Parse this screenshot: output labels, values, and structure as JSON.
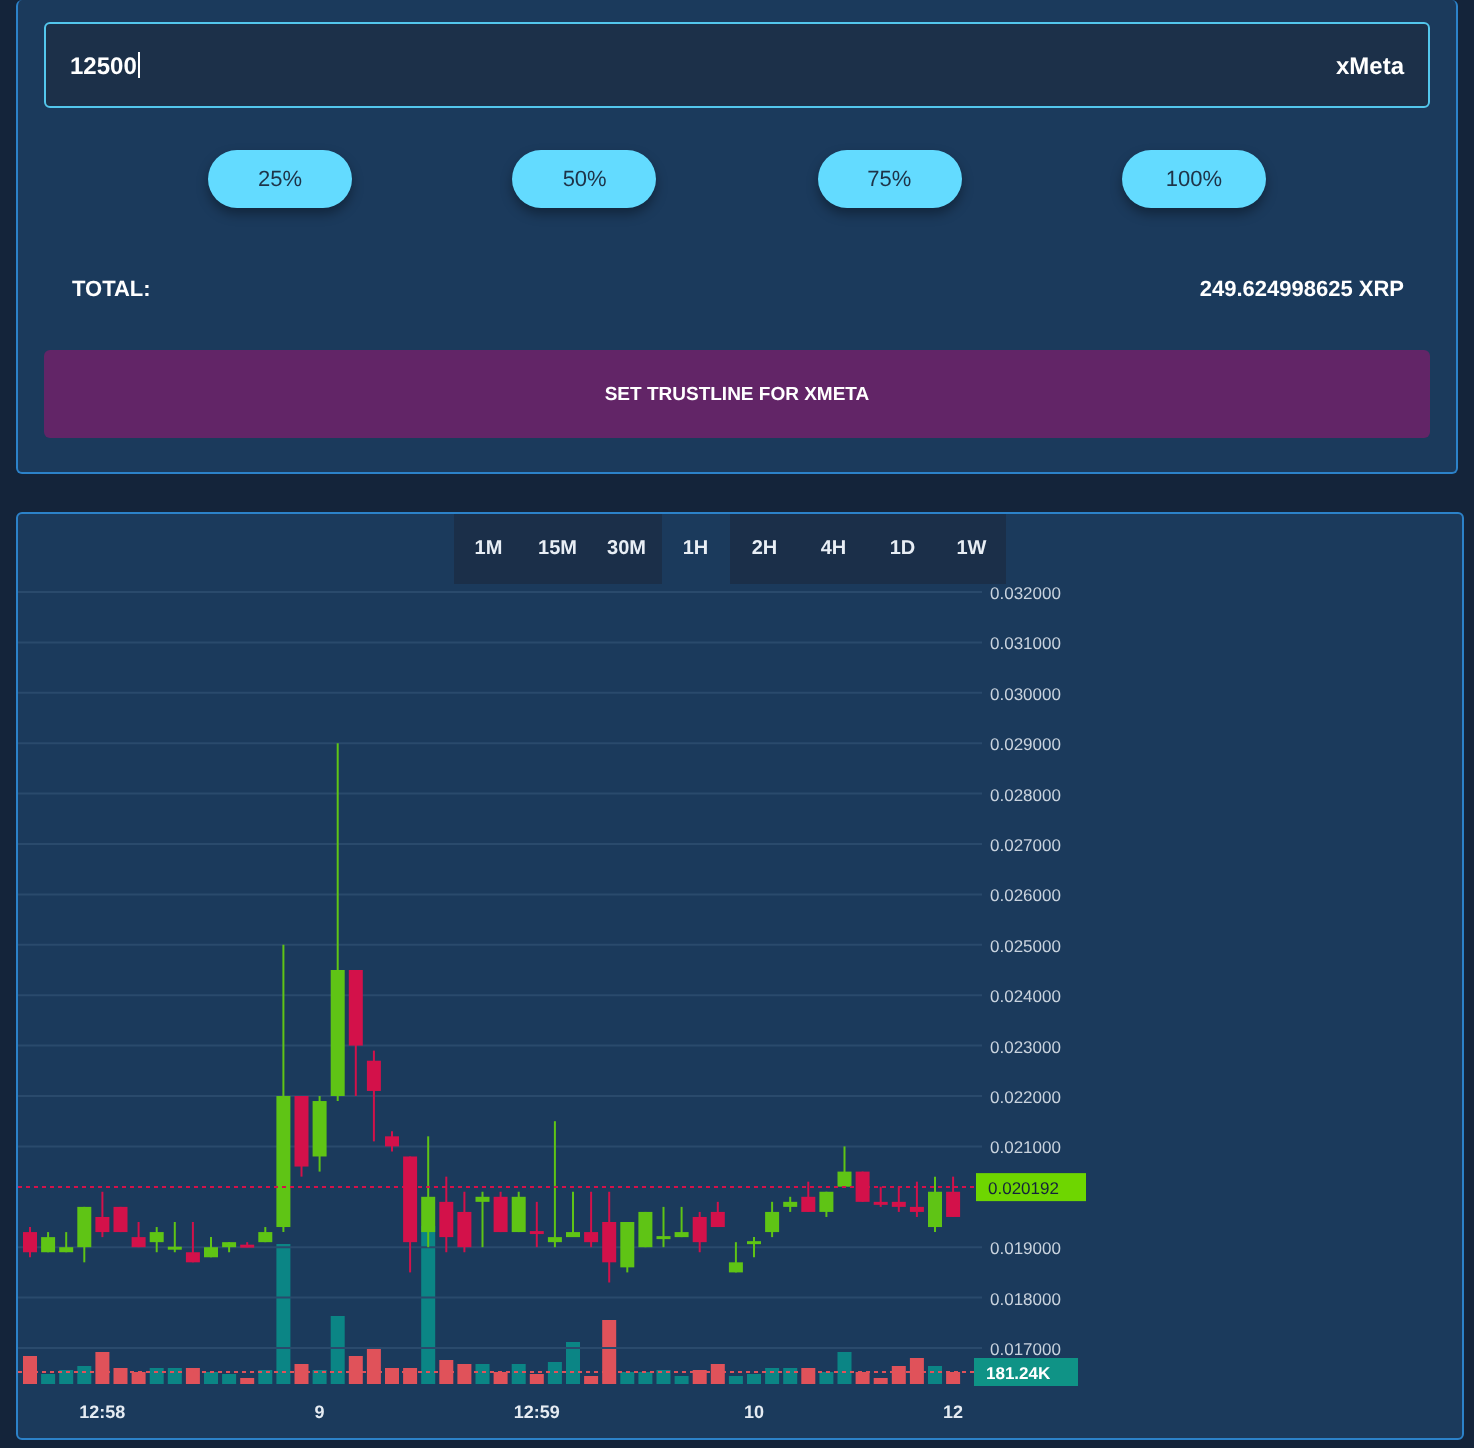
{
  "order": {
    "amount": {
      "value": "12500",
      "unit": "xMeta"
    },
    "percent_buttons": [
      "25%",
      "50%",
      "75%",
      "100%"
    ],
    "total": {
      "label": "TOTAL:",
      "value": "249.624998625 XRP"
    },
    "submit_button": "SET TRUSTLINE FOR XMETA"
  },
  "chart": {
    "timeframes": [
      {
        "label": "1M",
        "selected": false
      },
      {
        "label": "15M",
        "selected": false
      },
      {
        "label": "30M",
        "selected": false
      },
      {
        "label": "1H",
        "selected": true
      },
      {
        "label": "2H",
        "selected": false
      },
      {
        "label": "4H",
        "selected": false
      },
      {
        "label": "1D",
        "selected": false
      },
      {
        "label": "1W",
        "selected": false
      }
    ],
    "chart_data": {
      "type": "candlestick",
      "categories": [
        null,
        null,
        null,
        null,
        "12:58",
        null,
        null,
        null,
        null,
        null,
        null,
        null,
        null,
        null,
        null,
        null,
        "9",
        null,
        null,
        null,
        null,
        null,
        null,
        null,
        null,
        null,
        null,
        null,
        "12:59",
        null,
        null,
        null,
        null,
        null,
        null,
        null,
        null,
        null,
        null,
        null,
        "10",
        null,
        null,
        null,
        null,
        null,
        null,
        null,
        null,
        null,
        null,
        "12"
      ],
      "ohlc": [
        [
          0.0193,
          0.0194,
          0.0188,
          0.0189
        ],
        [
          0.0189,
          0.0193,
          0.0189,
          0.0192
        ],
        [
          0.0189,
          0.0193,
          0.0189,
          0.019
        ],
        [
          0.019,
          0.0198,
          0.0187,
          0.0198
        ],
        [
          0.0196,
          0.0201,
          0.0192,
          0.0193
        ],
        [
          0.0198,
          0.0198,
          0.0193,
          0.0193
        ],
        [
          0.0192,
          0.0195,
          0.019,
          0.019
        ],
        [
          0.0191,
          0.0194,
          0.0189,
          0.0193
        ],
        [
          0.019,
          0.0195,
          0.0189,
          0.01901
        ],
        [
          0.0189,
          0.0195,
          0.0187,
          0.0187
        ],
        [
          0.0188,
          0.0192,
          0.0188,
          0.019
        ],
        [
          0.019,
          0.0191,
          0.0189,
          0.0191
        ],
        [
          0.01905,
          0.0191,
          0.019,
          0.01902
        ],
        [
          0.0191,
          0.0194,
          0.0191,
          0.0193
        ],
        [
          0.0194,
          0.025,
          0.0193,
          0.022
        ],
        [
          0.022,
          0.022,
          0.0204,
          0.0206
        ],
        [
          0.0208,
          0.022,
          0.0205,
          0.0219
        ],
        [
          0.022,
          0.029,
          0.0219,
          0.0245
        ],
        [
          0.0245,
          0.0245,
          0.022,
          0.023
        ],
        [
          0.0227,
          0.0229,
          0.0211,
          0.0221
        ],
        [
          0.0212,
          0.0213,
          0.0209,
          0.021
        ],
        [
          0.0208,
          0.0208,
          0.0185,
          0.0191
        ],
        [
          0.0193,
          0.0212,
          0.019,
          0.02
        ],
        [
          0.0199,
          0.0204,
          0.0189,
          0.0192
        ],
        [
          0.0197,
          0.0201,
          0.0189,
          0.019
        ],
        [
          0.0199,
          0.0201,
          0.019,
          0.02
        ],
        [
          0.02,
          0.0201,
          0.0193,
          0.0193
        ],
        [
          0.0193,
          0.0201,
          0.0193,
          0.02
        ],
        [
          0.01932,
          0.0199,
          0.019,
          0.0193
        ],
        [
          0.0191,
          0.0215,
          0.019,
          0.0192
        ],
        [
          0.0192,
          0.0201,
          0.0192,
          0.0193
        ],
        [
          0.0193,
          0.0201,
          0.019,
          0.0191
        ],
        [
          0.0195,
          0.0201,
          0.0183,
          0.0187
        ],
        [
          0.0186,
          0.0195,
          0.0185,
          0.0195
        ],
        [
          0.019,
          0.0197,
          0.019,
          0.0197
        ],
        [
          0.0192,
          0.0198,
          0.019,
          0.01922
        ],
        [
          0.0192,
          0.0198,
          0.0192,
          0.0193
        ],
        [
          0.0196,
          0.0197,
          0.0189,
          0.0191
        ],
        [
          0.0197,
          0.0199,
          0.0194,
          0.0194
        ],
        [
          0.0185,
          0.0191,
          0.0185,
          0.0187
        ],
        [
          0.0191,
          0.0192,
          0.0188,
          0.01912
        ],
        [
          0.0193,
          0.0199,
          0.0192,
          0.0197
        ],
        [
          0.0198,
          0.02,
          0.0197,
          0.0199
        ],
        [
          0.02,
          0.0203,
          0.0197,
          0.0197
        ],
        [
          0.0197,
          0.0201,
          0.0196,
          0.0201
        ],
        [
          0.0202,
          0.021,
          0.0202,
          0.0205
        ],
        [
          0.0205,
          0.0205,
          0.0199,
          0.0199
        ],
        [
          0.0199,
          0.0202,
          0.0198,
          0.01985
        ],
        [
          0.0199,
          0.0202,
          0.0197,
          0.0198
        ],
        [
          0.0198,
          0.0203,
          0.0196,
          0.0197
        ],
        [
          0.0194,
          0.0204,
          0.0193,
          0.0201
        ],
        [
          0.0201,
          0.0204,
          0.0196,
          0.0196
        ]
      ],
      "ylim": [
        0.017,
        0.032
      ],
      "grid": true,
      "ref_lines": [
        {
          "axis": "y",
          "value": 0.020192,
          "label": "0.020192",
          "color": "#d3114a"
        }
      ],
      "yticks": [
        {
          "value": 0.032,
          "label": "0.032000"
        },
        {
          "value": 0.031,
          "label": "0.031000"
        },
        {
          "value": 0.03,
          "label": "0.030000"
        },
        {
          "value": 0.029,
          "label": "0.029000"
        },
        {
          "value": 0.028,
          "label": "0.028000"
        },
        {
          "value": 0.027,
          "label": "0.027000"
        },
        {
          "value": 0.026,
          "label": "0.026000"
        },
        {
          "value": 0.025,
          "label": "0.025000"
        },
        {
          "value": 0.024,
          "label": "0.024000"
        },
        {
          "value": 0.023,
          "label": "0.023000"
        },
        {
          "value": 0.022,
          "label": "0.022000"
        },
        {
          "value": 0.021,
          "label": "0.021000"
        },
        {
          "value": 0.019,
          "label": "0.019000"
        },
        {
          "value": 0.018,
          "label": "0.018000"
        },
        {
          "value": 0.017,
          "label": "0.017000"
        }
      ]
    },
    "volume_label": "181.24K"
  }
}
